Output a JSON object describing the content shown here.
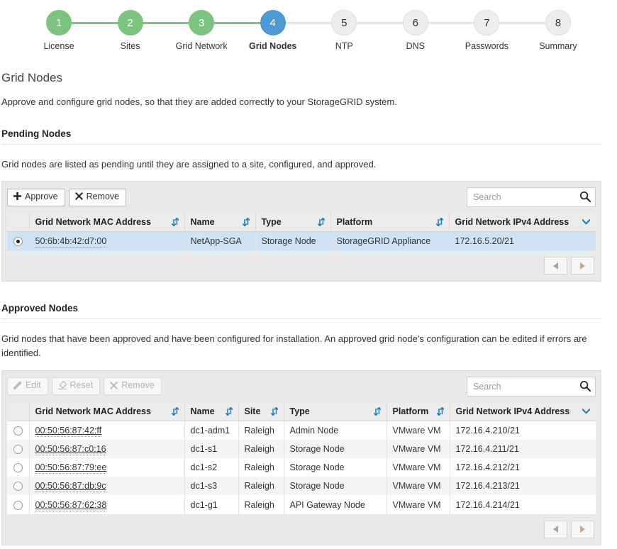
{
  "wizard": {
    "steps": [
      {
        "number": "1",
        "label": "License",
        "state": "done"
      },
      {
        "number": "2",
        "label": "Sites",
        "state": "done"
      },
      {
        "number": "3",
        "label": "Grid Network",
        "state": "done"
      },
      {
        "number": "4",
        "label": "Grid Nodes",
        "state": "current"
      },
      {
        "number": "5",
        "label": "NTP",
        "state": "todo"
      },
      {
        "number": "6",
        "label": "DNS",
        "state": "todo"
      },
      {
        "number": "7",
        "label": "Passwords",
        "state": "todo"
      },
      {
        "number": "8",
        "label": "Summary",
        "state": "todo"
      }
    ],
    "colors": {
      "done": "#7ac47f",
      "current": "#4c9ad4",
      "todo": "#ededed",
      "connector_done": "#7ac47f",
      "connector_todo": "#e4e4e4"
    }
  },
  "page": {
    "title": "Grid Nodes",
    "description": "Approve and configure grid nodes, so that they are added correctly to your StorageGRID system."
  },
  "pending": {
    "section_title": "Pending Nodes",
    "section_desc": "Grid nodes are listed as pending until they are assigned to a site, configured, and approved.",
    "toolbar": {
      "approve_label": "Approve",
      "approve_icon": "plus-icon",
      "remove_label": "Remove",
      "remove_icon": "x-icon",
      "search_placeholder": "Search",
      "search_value": "",
      "search_icon": "search-icon"
    },
    "columns": [
      {
        "label": "Grid Network MAC Address",
        "sort": "sort-both-icon"
      },
      {
        "label": "Name",
        "sort": "sort-both-icon"
      },
      {
        "label": "Type",
        "sort": "sort-both-icon"
      },
      {
        "label": "Platform",
        "sort": "sort-both-icon"
      },
      {
        "label": "Grid Network IPv4 Address",
        "sort": "chevron-down-icon"
      }
    ],
    "rows": [
      {
        "selected": true,
        "mac": "50:6b:4b:42:d7:00",
        "name": "NetApp-SGA",
        "type": "Storage Node",
        "platform": "StorageGRID Appliance",
        "ipv4": "172.16.5.20/21"
      }
    ],
    "pager": {
      "prev_icon": "triangle-left-icon",
      "next_icon": "triangle-right-icon"
    }
  },
  "approved": {
    "section_title": "Approved Nodes",
    "section_desc": "Grid nodes that have been approved and have been configured for installation. An approved grid node's configuration can be edited if errors are identified.",
    "toolbar": {
      "edit_label": "Edit",
      "edit_icon": "pencil-icon",
      "reset_label": "Reset",
      "reset_icon": "eraser-icon",
      "remove_label": "Remove",
      "remove_icon": "x-icon",
      "search_placeholder": "Search",
      "search_value": "",
      "search_icon": "search-icon"
    },
    "columns": [
      {
        "label": "Grid Network MAC Address",
        "sort": "sort-both-icon"
      },
      {
        "label": "Name",
        "sort": "sort-both-icon"
      },
      {
        "label": "Site",
        "sort": "sort-both-icon"
      },
      {
        "label": "Type",
        "sort": "sort-both-icon"
      },
      {
        "label": "Platform",
        "sort": "sort-both-icon"
      },
      {
        "label": "Grid Network IPv4 Address",
        "sort": "chevron-down-icon"
      }
    ],
    "rows": [
      {
        "selected": false,
        "mac": "00:50:56:87:42:ff",
        "name": "dc1-adm1",
        "site": "Raleigh",
        "type": "Admin Node",
        "platform": "VMware VM",
        "ipv4": "172.16.4.210/21"
      },
      {
        "selected": false,
        "mac": "00:50:56:87:c0:16",
        "name": "dc1-s1",
        "site": "Raleigh",
        "type": "Storage Node",
        "platform": "VMware VM",
        "ipv4": "172.16.4.211/21"
      },
      {
        "selected": false,
        "mac": "00:50:56:87:79:ee",
        "name": "dc1-s2",
        "site": "Raleigh",
        "type": "Storage Node",
        "platform": "VMware VM",
        "ipv4": "172.16.4.212/21"
      },
      {
        "selected": false,
        "mac": "00:50:56:87:db:9c",
        "name": "dc1-s3",
        "site": "Raleigh",
        "type": "Storage Node",
        "platform": "VMware VM",
        "ipv4": "172.16.4.213/21"
      },
      {
        "selected": false,
        "mac": "00:50:56:87:62:38",
        "name": "dc1-g1",
        "site": "Raleigh",
        "type": "API Gateway Node",
        "platform": "VMware VM",
        "ipv4": "172.16.4.214/21"
      }
    ],
    "pager": {
      "prev_icon": "triangle-left-icon",
      "next_icon": "triangle-right-icon"
    }
  }
}
